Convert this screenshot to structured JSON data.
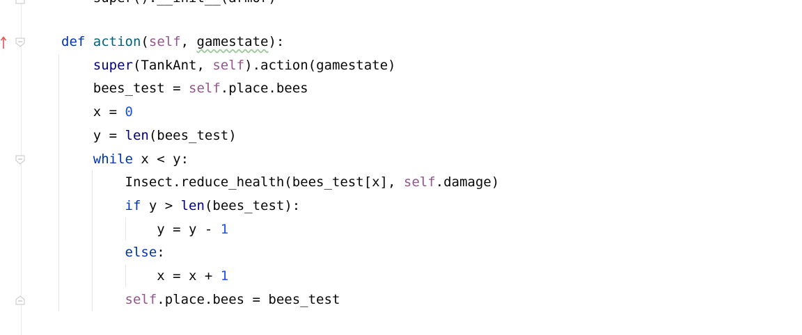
{
  "editor": {
    "top_partial_line": "    super().__init__(armor)",
    "lines": [
      {
        "id": "def",
        "tokens": [
          [
            "kw",
            "def"
          ],
          [
            "t",
            " "
          ],
          [
            "fn",
            "action"
          ],
          [
            "t",
            "("
          ],
          [
            "slf",
            "self"
          ],
          [
            "t",
            ", "
          ],
          [
            "warn",
            "gamestate"
          ],
          [
            "t",
            "):"
          ]
        ]
      },
      {
        "id": "super",
        "tokens": [
          [
            "t",
            "    "
          ],
          [
            "bi",
            "super"
          ],
          [
            "t",
            "(TankAnt, "
          ],
          [
            "slf",
            "self"
          ],
          [
            "t",
            ").action(gamestate)"
          ]
        ]
      },
      {
        "id": "bees",
        "tokens": [
          [
            "t",
            "    bees_test = "
          ],
          [
            "slf",
            "self"
          ],
          [
            "t",
            ".place.bees"
          ]
        ]
      },
      {
        "id": "x0",
        "tokens": [
          [
            "t",
            "    x = "
          ],
          [
            "num",
            "0"
          ]
        ]
      },
      {
        "id": "ylen",
        "tokens": [
          [
            "t",
            "    y = "
          ],
          [
            "bi",
            "len"
          ],
          [
            "t",
            "(bees_test)"
          ]
        ]
      },
      {
        "id": "while",
        "tokens": [
          [
            "t",
            "    "
          ],
          [
            "kw",
            "while"
          ],
          [
            "t",
            " x < y:"
          ]
        ]
      },
      {
        "id": "reduce",
        "tokens": [
          [
            "t",
            "        Insect.reduce_health(bees_test[x], "
          ],
          [
            "slf",
            "self"
          ],
          [
            "t",
            ".damage)"
          ]
        ]
      },
      {
        "id": "if",
        "tokens": [
          [
            "t",
            "        "
          ],
          [
            "kw",
            "if"
          ],
          [
            "t",
            " y > "
          ],
          [
            "bi",
            "len"
          ],
          [
            "t",
            "(bees_test):"
          ]
        ]
      },
      {
        "id": "ydec",
        "tokens": [
          [
            "t",
            "            y = y - "
          ],
          [
            "num",
            "1"
          ]
        ]
      },
      {
        "id": "else",
        "tokens": [
          [
            "t",
            "        "
          ],
          [
            "kw",
            "else"
          ],
          [
            "t",
            ":"
          ]
        ]
      },
      {
        "id": "xinc",
        "tokens": [
          [
            "t",
            "            x = x + "
          ],
          [
            "num",
            "1"
          ]
        ]
      },
      {
        "id": "assign",
        "tokens": [
          [
            "t",
            "        "
          ],
          [
            "slf",
            "self"
          ],
          [
            "t",
            ".place.bees = bees_test"
          ]
        ]
      }
    ]
  },
  "colors": {
    "keyword": "#0033b3",
    "function": "#00627a",
    "self": "#94558d",
    "number": "#1750eb",
    "builtin": "#000080",
    "override_marker": "#e05555"
  }
}
